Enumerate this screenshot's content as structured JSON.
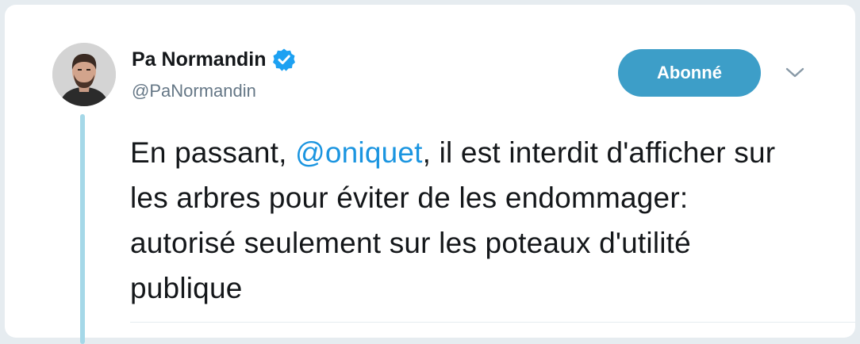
{
  "tweet": {
    "author": {
      "name": "Pa Normandin",
      "handle": "@PaNormandin",
      "verified": true,
      "avatar_icon": "avatar-photo"
    },
    "follow_label": "Abonné",
    "more_icon": "chevron-down-icon",
    "text_before": "En passant, ",
    "mention": "@oniquet",
    "text_after": ", il est interdit d'afficher sur les arbres pour éviter de les endommager: autorisé seulement sur les poteaux d'utilité publique"
  },
  "colors": {
    "accent": "#3d9ec8",
    "link": "#1b95e0",
    "verified": "#1da1f2",
    "thread_line": "#a5d8e8"
  }
}
